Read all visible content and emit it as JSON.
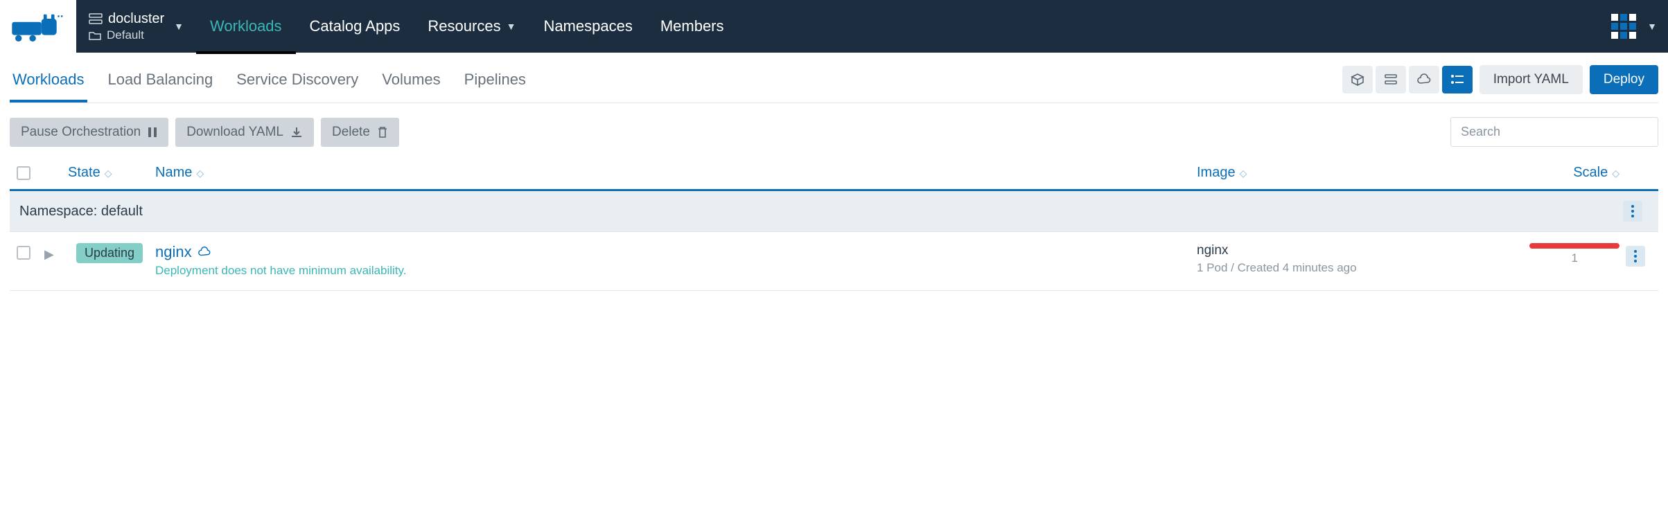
{
  "header": {
    "cluster_name": "docluster",
    "project_name": "Default",
    "nav": {
      "workloads": "Workloads",
      "catalog": "Catalog Apps",
      "resources": "Resources",
      "namespaces": "Namespaces",
      "members": "Members"
    }
  },
  "subnav": {
    "workloads": "Workloads",
    "lb": "Load Balancing",
    "sd": "Service Discovery",
    "volumes": "Volumes",
    "pipelines": "Pipelines",
    "import_yaml": "Import YAML",
    "deploy": "Deploy"
  },
  "toolbar": {
    "pause": "Pause Orchestration",
    "download": "Download YAML",
    "delete": "Delete",
    "search_placeholder": "Search"
  },
  "table": {
    "headers": {
      "state": "State",
      "name": "Name",
      "image": "Image",
      "scale": "Scale"
    },
    "group_label": "Namespace: default",
    "rows": [
      {
        "state": "Updating",
        "name": "nginx",
        "name_sub": "Deployment does not have minimum availability.",
        "image": "nginx",
        "image_sub": "1 Pod / Created 4 minutes ago",
        "scale": "1"
      }
    ]
  }
}
